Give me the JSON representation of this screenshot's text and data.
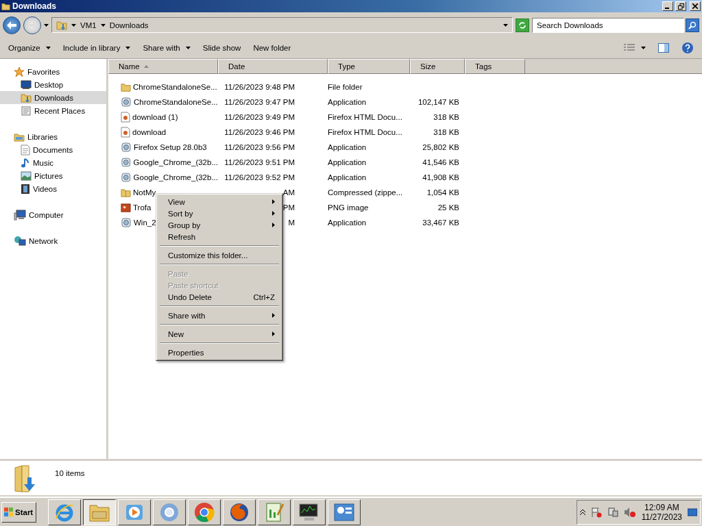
{
  "window": {
    "title": "Downloads"
  },
  "address": {
    "crumbs": [
      "VM1",
      "Downloads"
    ]
  },
  "search": {
    "placeholder": "Search Downloads"
  },
  "toolbar": [
    {
      "label": "Organize",
      "dropdown": true
    },
    {
      "label": "Include in library",
      "dropdown": true
    },
    {
      "label": "Share with",
      "dropdown": true
    },
    {
      "label": "Slide show",
      "dropdown": false
    },
    {
      "label": "New folder",
      "dropdown": false
    }
  ],
  "navigation": [
    {
      "label": "Favorites",
      "kind": "favorites",
      "selected": false,
      "children": [
        {
          "label": "Desktop",
          "kind": "desktop",
          "selected": false
        },
        {
          "label": "Downloads",
          "kind": "downloads",
          "selected": true
        },
        {
          "label": "Recent Places",
          "kind": "recent",
          "selected": false
        }
      ]
    },
    {
      "label": "Libraries",
      "kind": "libraries",
      "selected": false,
      "children": [
        {
          "label": "Documents",
          "kind": "documents",
          "selected": false
        },
        {
          "label": "Music",
          "kind": "music",
          "selected": false
        },
        {
          "label": "Pictures",
          "kind": "pictures",
          "selected": false
        },
        {
          "label": "Videos",
          "kind": "videos",
          "selected": false
        }
      ]
    },
    {
      "label": "Computer",
      "kind": "computer",
      "selected": false
    },
    {
      "label": "Network",
      "kind": "network",
      "selected": false
    }
  ],
  "columns": [
    {
      "label": "Name",
      "sorted": true
    },
    {
      "label": "Date",
      "sorted": false
    },
    {
      "label": "Type",
      "sorted": false
    },
    {
      "label": "Size",
      "sorted": false
    },
    {
      "label": "Tags",
      "sorted": false
    }
  ],
  "rows": [
    {
      "kind": "folder",
      "name": "ChromeStandaloneSe...",
      "date": "11/26/2023 9:48 PM",
      "type": "File folder"
    },
    {
      "kind": "app",
      "name": "ChromeStandaloneSe...",
      "date": "11/26/2023 9:47 PM",
      "type": "Application",
      "size": "102,147 KB"
    },
    {
      "kind": "html",
      "name": "download (1)",
      "date": "11/26/2023 9:49 PM",
      "type": "Firefox HTML Docu...",
      "size": "318 KB"
    },
    {
      "kind": "html",
      "name": "download",
      "date": "11/26/2023 9:46 PM",
      "type": "Firefox HTML Docu...",
      "size": "318 KB"
    },
    {
      "kind": "app",
      "name": "Firefox Setup 28.0b3",
      "date": "11/26/2023 9:56 PM",
      "type": "Application",
      "size": "25,802 KB"
    },
    {
      "kind": "app",
      "name": "Google_Chrome_(32b...",
      "date": "11/26/2023 9:51 PM",
      "type": "Application",
      "size": "41,546 KB"
    },
    {
      "kind": "app",
      "name": "Google_Chrome_(32b...",
      "date": "11/26/2023 9:52 PM",
      "type": "Application",
      "size": "41,908 KB"
    },
    {
      "kind": "zip",
      "name": "NotMy",
      "date": "AM",
      "type": "Compressed (zippe...",
      "size": "1,054 KB"
    },
    {
      "kind": "image",
      "name": "Trofa",
      "date": "PM",
      "type": "PNG image",
      "size": "25 KB"
    },
    {
      "kind": "app",
      "name": "Win_2",
      "date": "M",
      "type": "Application",
      "size": "33,467 KB"
    }
  ],
  "context_menu": [
    {
      "kind": "item",
      "label": "View",
      "submenu": true,
      "disabled": false
    },
    {
      "kind": "item",
      "label": "Sort by",
      "submenu": true,
      "disabled": false
    },
    {
      "kind": "item",
      "label": "Group by",
      "submenu": true,
      "disabled": false
    },
    {
      "kind": "item",
      "label": "Refresh",
      "submenu": false,
      "disabled": false
    },
    {
      "kind": "separator"
    },
    {
      "kind": "item",
      "label": "Customize this folder...",
      "submenu": false,
      "disabled": false
    },
    {
      "kind": "separator"
    },
    {
      "kind": "item",
      "label": "Paste",
      "submenu": false,
      "disabled": true
    },
    {
      "kind": "item",
      "label": "Paste shortcut",
      "submenu": false,
      "disabled": true
    },
    {
      "kind": "item",
      "label": "Undo Delete",
      "shortcut": "Ctrl+Z",
      "submenu": false,
      "disabled": false
    },
    {
      "kind": "separator"
    },
    {
      "kind": "item",
      "label": "Share with",
      "submenu": true,
      "disabled": false
    },
    {
      "kind": "separator"
    },
    {
      "kind": "item",
      "label": "New",
      "submenu": true,
      "disabled": false
    },
    {
      "kind": "separator"
    },
    {
      "kind": "item",
      "label": "Properties",
      "submenu": false,
      "disabled": false
    }
  ],
  "details": {
    "text": "10 items"
  },
  "taskbar": {
    "start": "Start",
    "apps": [
      {
        "kind": "ie",
        "selected": false
      },
      {
        "kind": "explorer",
        "selected": true
      },
      {
        "kind": "media",
        "selected": false
      },
      {
        "kind": "chromium",
        "selected": false
      },
      {
        "kind": "chrome",
        "selected": false
      },
      {
        "kind": "firefox",
        "selected": false
      },
      {
        "kind": "notepad",
        "selected": false
      },
      {
        "kind": "monitor",
        "selected": false
      },
      {
        "kind": "panel",
        "selected": false
      }
    ],
    "time": "12:09 AM",
    "date": "11/27/2023"
  }
}
